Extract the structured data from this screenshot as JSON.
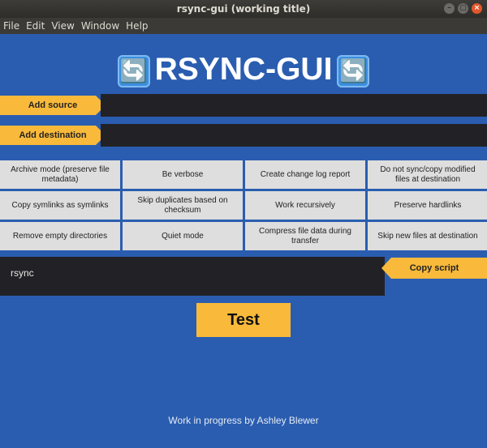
{
  "window": {
    "title": "rsync-gui (working title)",
    "buttons": [
      "–",
      "▢",
      "×"
    ]
  },
  "menubar": [
    "File",
    "Edit",
    "View",
    "Window",
    "Help"
  ],
  "app": {
    "title": "RSYNC-GUI",
    "icon": "sync-icon",
    "icon_glyph": "🔄"
  },
  "source": {
    "button_label": "Add source",
    "value": ""
  },
  "destination": {
    "button_label": "Add destination",
    "value": ""
  },
  "options": [
    "Archive mode (preserve file metadata)",
    "Be verbose",
    "Create change log report",
    "Do not sync/copy modified files at destination",
    "Copy symlinks as symlinks",
    "Skip duplicates based on checksum",
    "Work recursively",
    "Preserve hardlinks",
    "Remove empty directories",
    "Quiet mode",
    "Compress file data during transfer",
    "Skip new files at destination"
  ],
  "script": {
    "text": "rsync",
    "copy_label": "Copy script"
  },
  "test_label": "Test",
  "footer": "Work in progress by Ashley Blewer",
  "colors": {
    "background": "#2a5db0",
    "accent": "#f9b93a",
    "field": "#222226",
    "option": "#dedede"
  }
}
